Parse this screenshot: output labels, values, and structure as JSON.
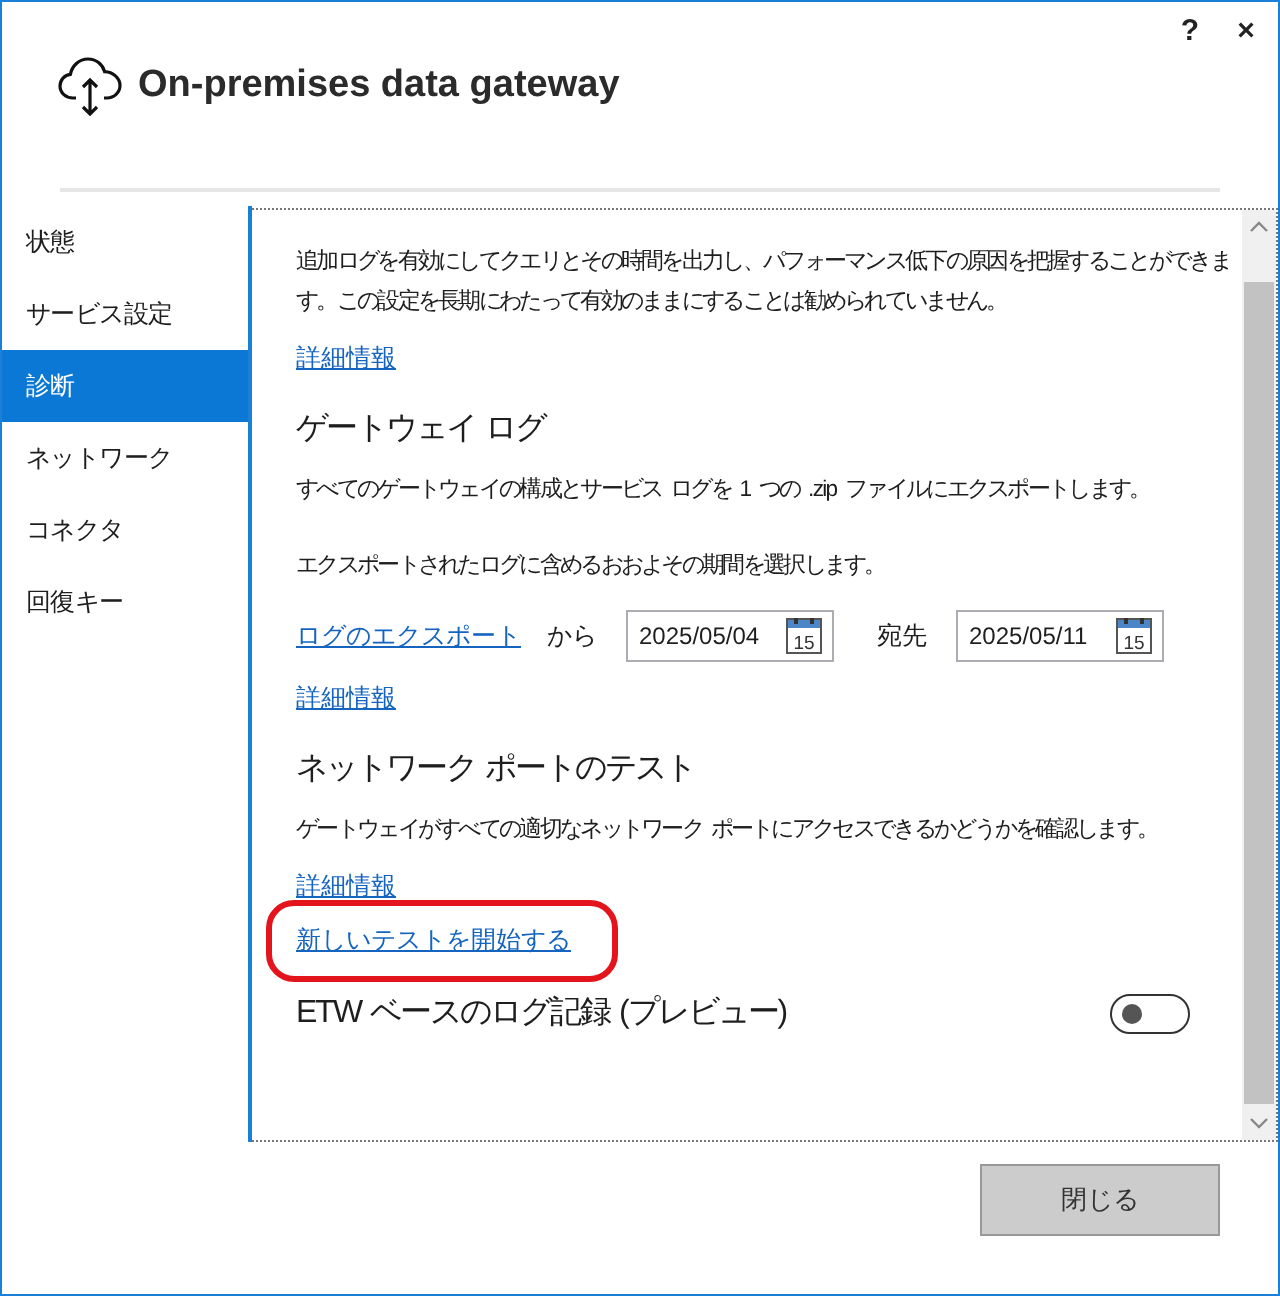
{
  "window": {
    "help_glyph": "?",
    "close_glyph": "×"
  },
  "header": {
    "title": "On-premises data gateway"
  },
  "sidebar": {
    "items": [
      {
        "label": "状態",
        "selected": false
      },
      {
        "label": "サービス設定",
        "selected": false
      },
      {
        "label": "診断",
        "selected": true
      },
      {
        "label": "ネットワーク",
        "selected": false
      },
      {
        "label": "コネクタ",
        "selected": false
      },
      {
        "label": "回復キー",
        "selected": false
      }
    ]
  },
  "content": [
    {
      "kind": "text",
      "text": "追加ログを有効にしてクエリとその時間を出力し、パフォーマンス低下の原因を把握することができます。この設定を長期にわたって有効のままにすることは勧められていません。"
    },
    {
      "kind": "link",
      "text": "詳細情報",
      "circled": false
    },
    {
      "kind": "heading",
      "text": "ゲートウェイ ログ"
    },
    {
      "kind": "text",
      "text": "すべてのゲートウェイの構成とサービス ログを 1 つの .zip ファイルにエクスポートします。"
    },
    {
      "kind": "text",
      "text": "エクスポートされたログに含めるおおよその期間を選択します。"
    },
    {
      "kind": "export_row",
      "link": "ログのエクスポート",
      "from_label": "から",
      "from": {
        "value": "2025/05/04",
        "calendar_day": "15"
      },
      "to_label": "宛先",
      "to": {
        "value": "2025/05/11",
        "calendar_day": "15"
      }
    },
    {
      "kind": "link",
      "text": "詳細情報",
      "circled": false
    },
    {
      "kind": "heading",
      "text": "ネットワーク ポートのテスト"
    },
    {
      "kind": "text",
      "text": "ゲートウェイがすべての適切なネットワーク ポートにアクセスできるかどうかを確認します。"
    },
    {
      "kind": "link",
      "text": "詳細情報",
      "circled": false
    },
    {
      "kind": "link",
      "text": "新しいテストを開始する",
      "circled": true
    },
    {
      "kind": "toggle_setting",
      "label": "ETW ベースのログ記録 (プレビュー)",
      "on": false
    }
  ],
  "footer": {
    "close_button": {
      "label": "閉じる"
    }
  }
}
